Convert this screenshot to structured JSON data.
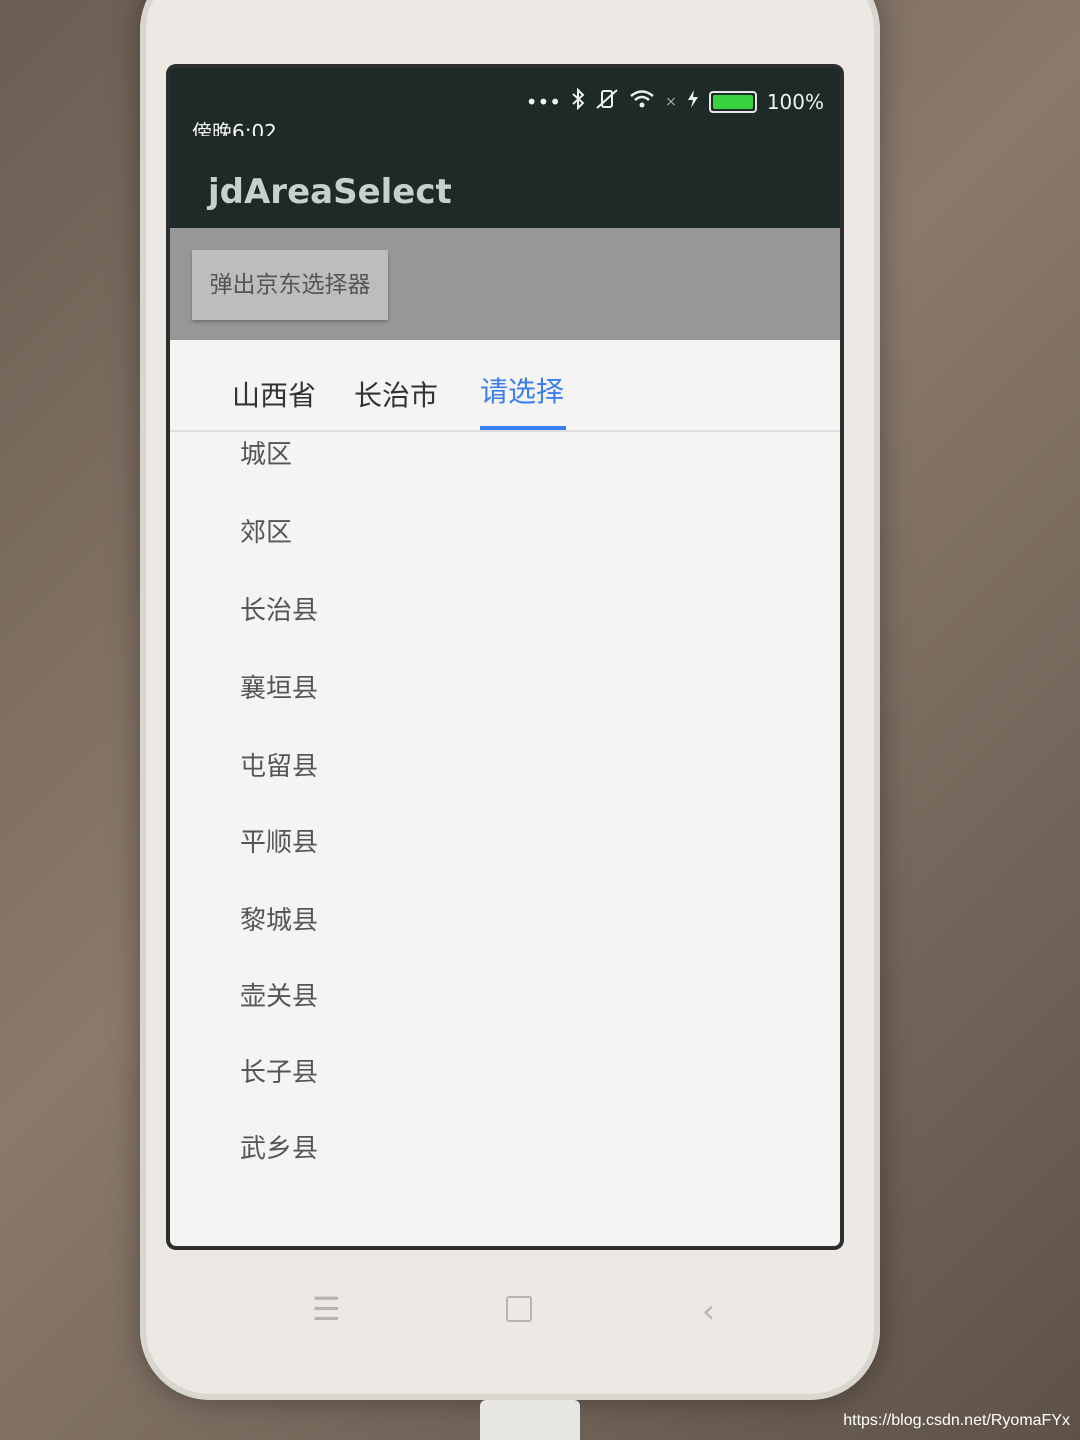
{
  "status_bar": {
    "time": "傍晚6:02",
    "icons": [
      "dots-icon",
      "bluetooth-icon",
      "vibrate-off-icon",
      "wifi-icon",
      "no-signal-icon",
      "charging-icon",
      "battery-icon"
    ],
    "battery_percent": "100%",
    "battery_level": 1.0
  },
  "app": {
    "title": "jdAreaSelect",
    "popup_button_label": "弹出京东选择器"
  },
  "area_selector": {
    "tabs": [
      "山西省",
      "长治市",
      "请选择"
    ],
    "active_tab_index": 2,
    "items": [
      "城区",
      "郊区",
      "长治县",
      "襄垣县",
      "屯留县",
      "平顺县",
      "黎城县",
      "壶关县",
      "长子县",
      "武乡县"
    ]
  },
  "colors": {
    "accent": "#3a7ef0",
    "toolbar": "#1d2a27",
    "battery": "#39d13f"
  },
  "nav_bar": {
    "menu_glyph": "☰",
    "back_glyph": "‹"
  },
  "watermark": "https://blog.csdn.net/RyomaFYx"
}
